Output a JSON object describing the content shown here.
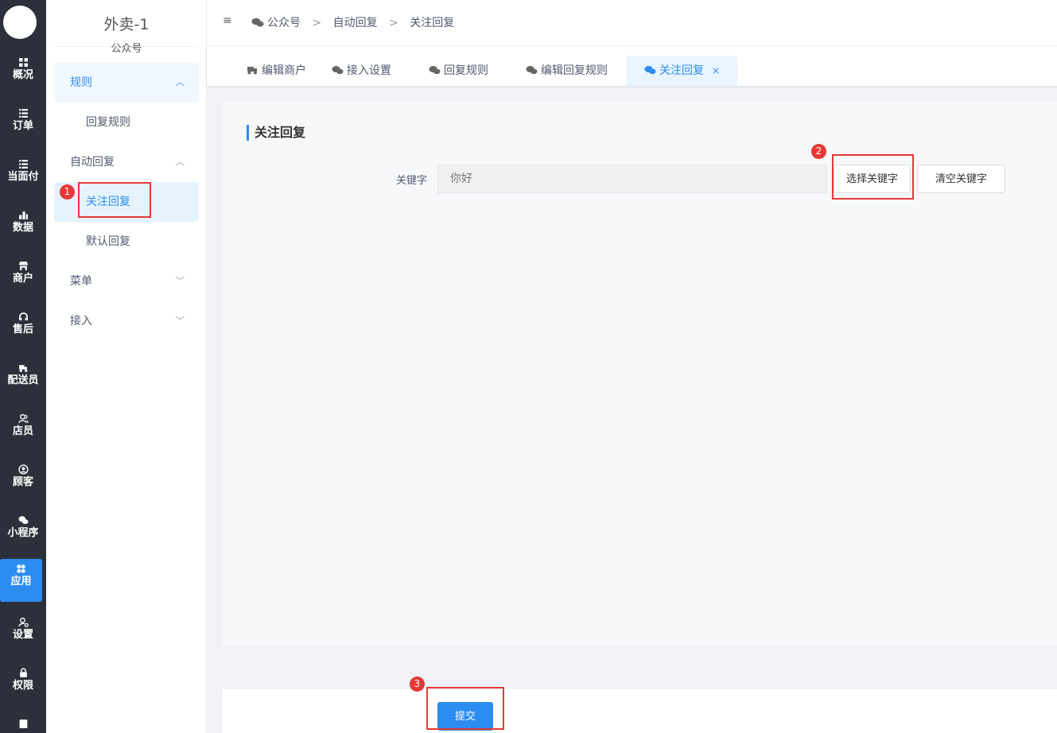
{
  "rail": {
    "items": [
      {
        "label": "概况",
        "icon": "dashboard-icon"
      },
      {
        "label": "订单",
        "icon": "list-icon"
      },
      {
        "label": "当面付",
        "icon": "list-icon"
      },
      {
        "label": "数据",
        "icon": "bar-chart-icon"
      },
      {
        "label": "商户",
        "icon": "store-icon"
      },
      {
        "label": "售后",
        "icon": "headset-icon"
      },
      {
        "label": "配送员",
        "icon": "delivery-icon"
      },
      {
        "label": "店员",
        "icon": "staff-icon"
      },
      {
        "label": "顾客",
        "icon": "customer-icon"
      },
      {
        "label": "小程序",
        "icon": "wechat-icon"
      },
      {
        "label": "应用",
        "icon": "apps-icon"
      },
      {
        "label": "设置",
        "icon": "settings-icon"
      },
      {
        "label": "权限",
        "icon": "lock-icon"
      }
    ],
    "active_label": "应用"
  },
  "side": {
    "title": "外卖-1",
    "subtitle": "公众号",
    "menu": {
      "rules": "规则",
      "reply_rules": "回复规则",
      "auto_reply": "自动回复",
      "follow_reply": "关注回复",
      "default_reply": "默认回复",
      "menu": "菜单",
      "access": "接入"
    }
  },
  "header": {
    "crumbs": [
      "公众号",
      "自动回复",
      "关注回复"
    ]
  },
  "tabs": [
    {
      "label": "编辑商户",
      "icon": "delivery-icon"
    },
    {
      "label": "接入设置",
      "icon": "wechat-icon"
    },
    {
      "label": "回复规则",
      "icon": "wechat-icon"
    },
    {
      "label": "编辑回复规则",
      "icon": "wechat-icon"
    },
    {
      "label": "关注回复",
      "icon": "wechat-icon",
      "active": true,
      "close": "×"
    }
  ],
  "form": {
    "section_title": "关注回复",
    "keyword_label": "关键字",
    "keyword_placeholder": "你好",
    "select_keyword": "选择关键字",
    "clear_keyword": "清空关键字",
    "submit": "提交"
  },
  "annotations": {
    "badges": [
      "1",
      "2",
      "3"
    ],
    "color": "#e53935"
  },
  "colors": {
    "accent": "#2d8cf0",
    "rail_bg": "#2b303a"
  }
}
